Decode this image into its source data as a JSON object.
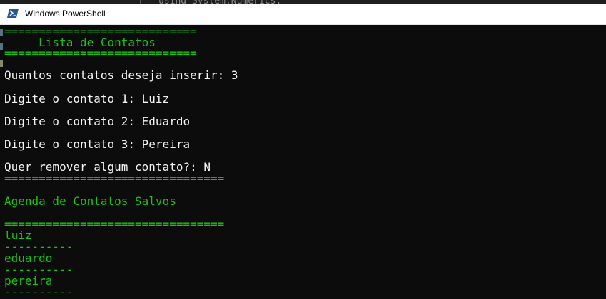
{
  "background_editor": {
    "partial_code": "using System.Numerics;"
  },
  "window": {
    "title": "Windows PowerShell",
    "icon": "powershell-icon"
  },
  "colors": {
    "console_bg": "#0c0c0c",
    "green": "#16c60c",
    "white": "#f2f2f2"
  },
  "console": {
    "header_rule_top": "============================",
    "header_title": "     Lista de Contatos",
    "header_rule_bottom": "============================",
    "prompt_count": "Quantos contatos deseja inserir: 3",
    "prompt_contact_1": "Digite o contato 1: Luiz",
    "prompt_contact_2": "Digite o contato 2: Eduardo",
    "prompt_contact_3": "Digite o contato 3: Pereira",
    "prompt_remove": "Quer remover algum contato?: N",
    "agenda_rule_top": "================================",
    "agenda_title": "Agenda de Contatos Salvos",
    "agenda_rule_bottom": "================================",
    "contacts": [
      {
        "name": "luiz",
        "separator": "----------"
      },
      {
        "name": "eduardo",
        "separator": "----------"
      },
      {
        "name": "pereira",
        "separator": "----------"
      }
    ]
  }
}
